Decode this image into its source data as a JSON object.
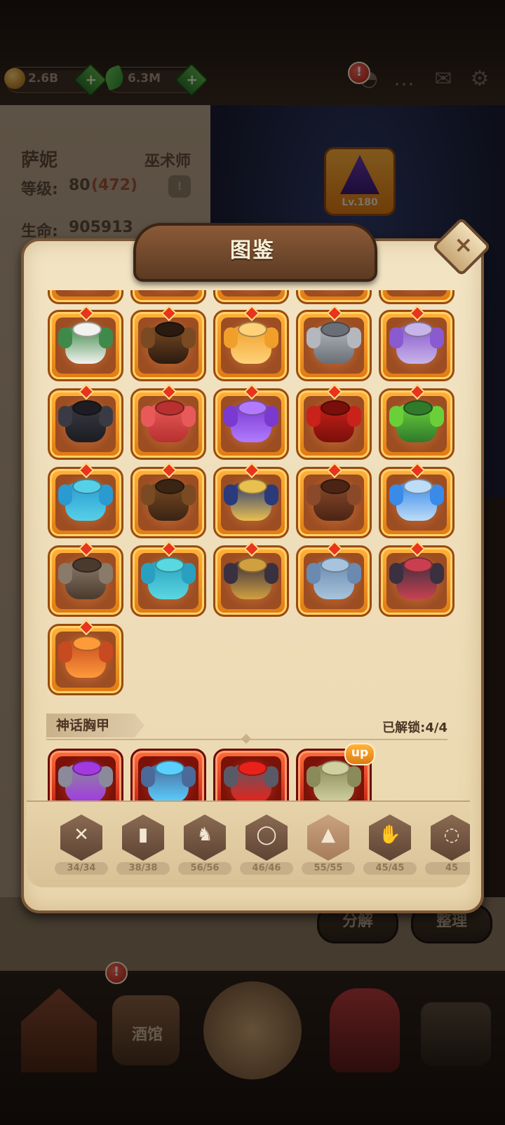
{
  "resources": {
    "gold": "2.6B",
    "gems": "6.3M",
    "gold_icon": "gold-coin-icon",
    "gem_icon": "green-leaf-gem-icon"
  },
  "top_alert": "!",
  "character": {
    "name": "萨妮",
    "class": "巫术师",
    "level_label": "等级:",
    "level": "80",
    "level_bonus": "(472)",
    "hp_label": "生命:",
    "hp": "905913",
    "hat_level": "Lv.180"
  },
  "modal": {
    "title": "图鉴",
    "close_icon": "close-x-icon",
    "section_title": "神话胸甲",
    "unlocked": "已解锁:4/4",
    "up_badge": "up"
  },
  "armor_items": [
    {
      "name": "fur-collar-green-cloak",
      "colors": [
        "#3f8a4a",
        "#f2f2ee"
      ]
    },
    {
      "name": "brown-leather-cloak",
      "colors": [
        "#7a4a22",
        "#2a1a10"
      ]
    },
    {
      "name": "golden-silk-cloak",
      "colors": [
        "#f0a02a",
        "#ffd27a"
      ]
    },
    {
      "name": "steel-plate-armor",
      "colors": [
        "#b4b8be",
        "#6a6e76"
      ]
    },
    {
      "name": "purple-ring-mail",
      "colors": [
        "#8a5ad0",
        "#c8b4e8"
      ]
    },
    {
      "name": "black-iron-armor",
      "colors": [
        "#3a3a44",
        "#1c1c22"
      ]
    },
    {
      "name": "red-silk-cape",
      "colors": [
        "#e85a5a",
        "#b83030"
      ]
    },
    {
      "name": "purple-mage-cape",
      "colors": [
        "#7a3ad0",
        "#b27aff"
      ]
    },
    {
      "name": "crimson-hooded-cloak",
      "colors": [
        "#c8221a",
        "#7a0e0a"
      ]
    },
    {
      "name": "slime-green-armor",
      "colors": [
        "#6ad03a",
        "#2f7a2b"
      ]
    },
    {
      "name": "azure-cape",
      "colors": [
        "#2a9ad0",
        "#56d0e8"
      ]
    },
    {
      "name": "brown-travel-cloak",
      "colors": [
        "#7a4a22",
        "#3a2414"
      ]
    },
    {
      "name": "navy-gold-mantle",
      "colors": [
        "#2a3a7a",
        "#e8c050"
      ]
    },
    {
      "name": "leather-trench-coat",
      "colors": [
        "#8a4a2a",
        "#4a2414"
      ]
    },
    {
      "name": "sky-blue-cape",
      "colors": [
        "#3a8ae8",
        "#bcdcf8"
      ]
    },
    {
      "name": "bronze-chestplate",
      "colors": [
        "#8a7a6a",
        "#4a3a2e"
      ]
    },
    {
      "name": "teal-shawl",
      "colors": [
        "#2aa0c0",
        "#5ad8e0"
      ]
    },
    {
      "name": "dark-gold-trim-armor",
      "colors": [
        "#3a3040",
        "#d0a040"
      ]
    },
    {
      "name": "blue-muscle-cuirass",
      "colors": [
        "#6a8ab0",
        "#a8c4dc"
      ]
    },
    {
      "name": "harness-vest",
      "colors": [
        "#3a3040",
        "#c84050"
      ]
    },
    {
      "name": "lava-rock-armor",
      "colors": [
        "#c84a20",
        "#ff9a3a"
      ]
    }
  ],
  "mythic_items": [
    {
      "name": "void-purple-plate",
      "colors": [
        "#8a8a9a",
        "#a23ae0"
      ]
    },
    {
      "name": "crystal-blue-plate",
      "colors": [
        "#4a6a9a",
        "#5ad0ff"
      ]
    },
    {
      "name": "crimson-dread-plate",
      "colors": [
        "#5a5a66",
        "#e8221a"
      ]
    },
    {
      "name": "olive-guardian-plate",
      "colors": [
        "#8a8a5a",
        "#d0d0a0"
      ]
    }
  ],
  "tabs": [
    {
      "icon": "sword-emblem-icon",
      "glyph": "✕",
      "count": "34/34"
    },
    {
      "icon": "book-icon",
      "glyph": "▮",
      "count": "38/38"
    },
    {
      "icon": "helmet-icon",
      "glyph": "♞",
      "count": "56/56"
    },
    {
      "icon": "necklace-icon",
      "glyph": "◯",
      "count": "46/46"
    },
    {
      "icon": "chest-armor-icon",
      "glyph": "▲",
      "count": "55/55"
    },
    {
      "icon": "glove-icon",
      "glyph": "✋",
      "count": "45/45"
    },
    {
      "icon": "ring-icon",
      "glyph": "◌",
      "count": "45"
    }
  ],
  "bottom_buttons": {
    "decompose": "分解",
    "organize": "整理"
  },
  "nav": {
    "tavern": "酒馆",
    "alert": "!"
  }
}
